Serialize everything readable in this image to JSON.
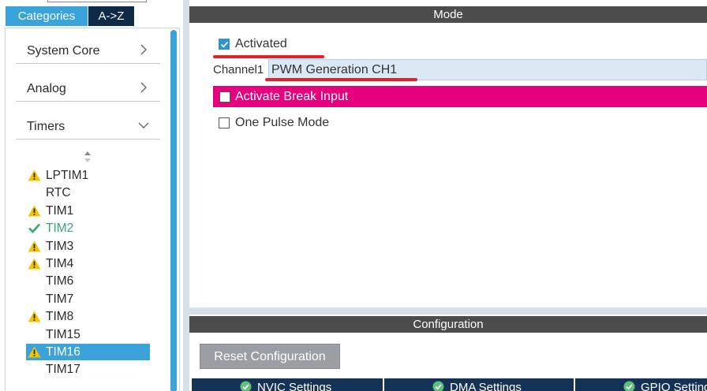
{
  "left_panel": {
    "tabs": {
      "categories": "Categories",
      "az": "A->Z"
    },
    "categories": [
      {
        "label": "System Core",
        "state": "collapsed"
      },
      {
        "label": "Analog",
        "state": "collapsed"
      },
      {
        "label": "Timers",
        "state": "expanded"
      }
    ],
    "peripherals": [
      {
        "label": "LPTIM1",
        "status": "warning"
      },
      {
        "label": "RTC",
        "status": "none"
      },
      {
        "label": "TIM1",
        "status": "warning"
      },
      {
        "label": "TIM2",
        "status": "ok"
      },
      {
        "label": "TIM3",
        "status": "warning"
      },
      {
        "label": "TIM4",
        "status": "warning"
      },
      {
        "label": "TIM6",
        "status": "none"
      },
      {
        "label": "TIM7",
        "status": "none"
      },
      {
        "label": "TIM8",
        "status": "warning"
      },
      {
        "label": "TIM15",
        "status": "none"
      },
      {
        "label": "TIM16",
        "status": "warning",
        "selected": true
      },
      {
        "label": "TIM17",
        "status": "none"
      }
    ]
  },
  "mode": {
    "header": "Mode",
    "activated": {
      "label": "Activated",
      "checked": true
    },
    "channel1": {
      "label": "Channel1",
      "value": "PWM Generation CH1"
    },
    "break_input": {
      "label": "Activate Break Input",
      "checked": false
    },
    "one_pulse": {
      "label": "One Pulse Mode",
      "checked": false
    }
  },
  "configuration": {
    "header": "Configuration",
    "reset_button": "Reset Configuration",
    "tabs": [
      {
        "label": "NVIC Settings",
        "icon": "check-circle-icon"
      },
      {
        "label": "DMA Settings",
        "icon": "check-circle-icon"
      },
      {
        "label": "GPIO Settings",
        "icon": "check-circle-icon"
      }
    ]
  },
  "colors": {
    "accent_blue": "#39a3dc",
    "dark_navy": "#0f2a47",
    "header_gray": "#4c4c4c",
    "break_pink": "#e6007e",
    "ok_green": "#3aa76d",
    "warning_yellow": "#f5c400",
    "annotation_red": "#e0202a"
  }
}
